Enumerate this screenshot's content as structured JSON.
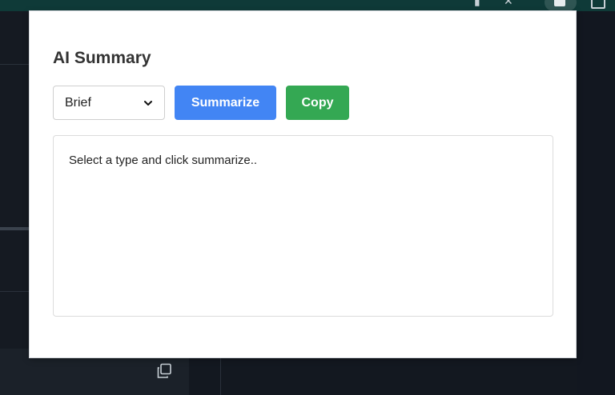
{
  "popup": {
    "title": "AI Summary",
    "summary_type": {
      "selected": "Brief",
      "options": [
        "Brief"
      ]
    },
    "summarize_label": "Summarize",
    "copy_label": "Copy",
    "result_placeholder": "Select a type and click summarize.."
  },
  "colors": {
    "summarize_button": "#4285f4",
    "copy_button": "#34a853",
    "title_text": "#333333",
    "browser_toolbar": "#0f3a38",
    "background_page": "#131820"
  },
  "icons": {
    "toolbar": [
      "pin-icon",
      "star-icon",
      "extension-icon",
      "tab-icon"
    ],
    "select": "chevron-down-icon",
    "background": "copy-icon"
  }
}
